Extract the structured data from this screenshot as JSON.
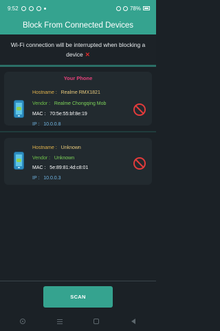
{
  "status_bar": {
    "time": "9:52",
    "battery": "78%"
  },
  "header": {
    "title": "Block From Connected Devices"
  },
  "notice": {
    "text": "Wi-Fi connection will be interrupted when blocking a device",
    "mark": "✕"
  },
  "devices": [
    {
      "badge": "Your Phone",
      "hostname_label": "Hostname :",
      "hostname": "Realme RMX1821",
      "vendor_label": "Vendor :",
      "vendor": "Realme Chongqing Mob",
      "mac_label": "MAC :",
      "mac": "70:5e:55:bf:8e:19",
      "ip_label": "IP :",
      "ip": "10.0.0.8"
    },
    {
      "badge": "",
      "hostname_label": "Hostname :",
      "hostname": "Unknown",
      "vendor_label": "Vendor :",
      "vendor": "Unknown",
      "mac_label": "MAC :",
      "mac": "5e:89:81:4d:c8:01",
      "ip_label": "IP :",
      "ip": "10.0.0.3"
    }
  ],
  "actions": {
    "scan_label": "SCAN"
  },
  "colors": {
    "primary": "#35a38f",
    "background": "#1b2126",
    "card": "#222a2f",
    "badge": "#e3417a",
    "block": "#e23b3b"
  },
  "icons": [
    "wifi-icon",
    "battery-icon",
    "phone-icon",
    "block-icon",
    "menu-icon",
    "home-icon",
    "back-icon",
    "accessibility-icon"
  ]
}
